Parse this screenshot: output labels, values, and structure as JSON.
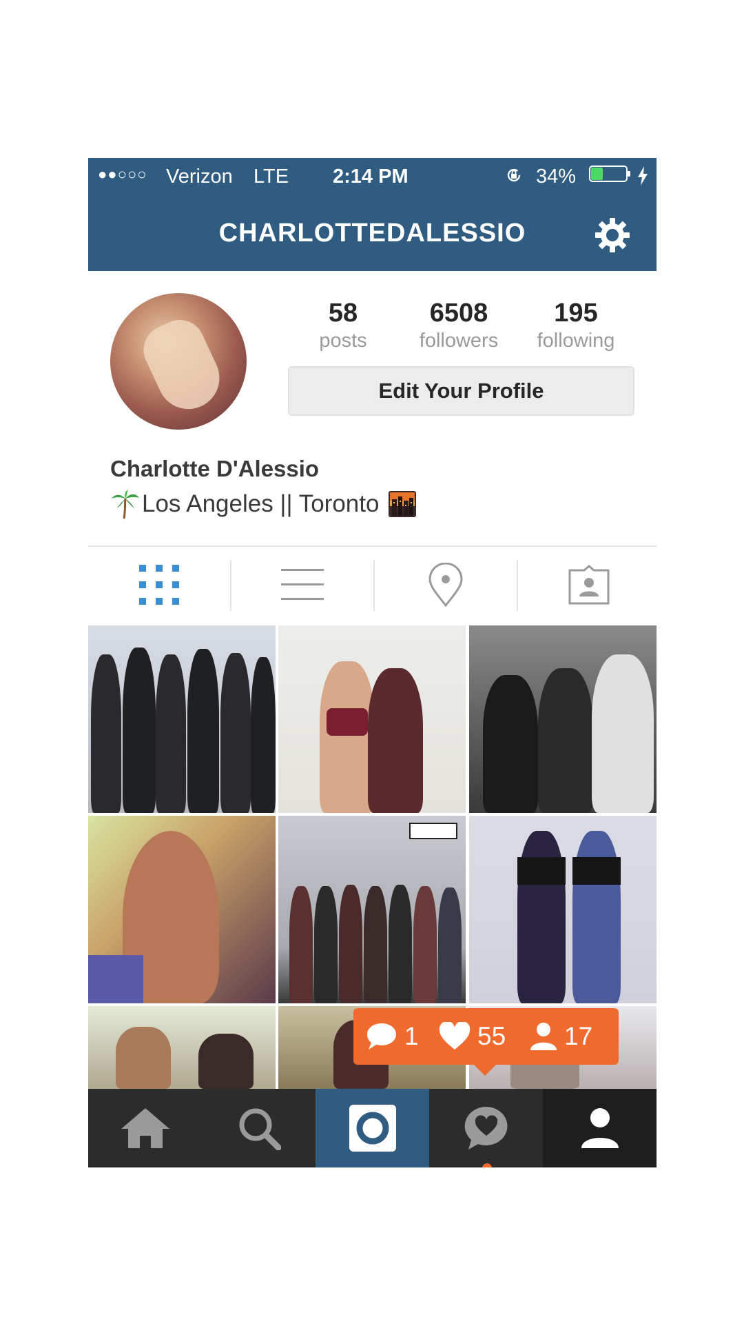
{
  "status_bar": {
    "signal": "●●○○○",
    "carrier": "Verizon",
    "network": "LTE",
    "time": "2:14 PM",
    "battery": "34%",
    "battery_level": 0.34
  },
  "header": {
    "title": "CHARLOTTEDALESSIO"
  },
  "profile": {
    "stats": [
      {
        "value": "58",
        "label": "posts"
      },
      {
        "value": "6508",
        "label": "followers"
      },
      {
        "value": "195",
        "label": "following"
      }
    ],
    "edit_button": "Edit Your Profile",
    "full_name": "Charlotte D'Alessio",
    "bio": "Los Angeles || Toronto"
  },
  "view_tabs": [
    "grid-icon",
    "list-icon",
    "location-pin-icon",
    "tagged-photos-icon"
  ],
  "notification": {
    "comments": "1",
    "likes": "55",
    "followers": "17"
  },
  "tab_bar": [
    "home-icon",
    "search-icon",
    "camera-icon",
    "activity-icon",
    "profile-icon"
  ],
  "colors": {
    "header_blue": "#305c82",
    "notification_orange": "#f06a2e",
    "active_tab_blue": "#3c8fcf"
  }
}
